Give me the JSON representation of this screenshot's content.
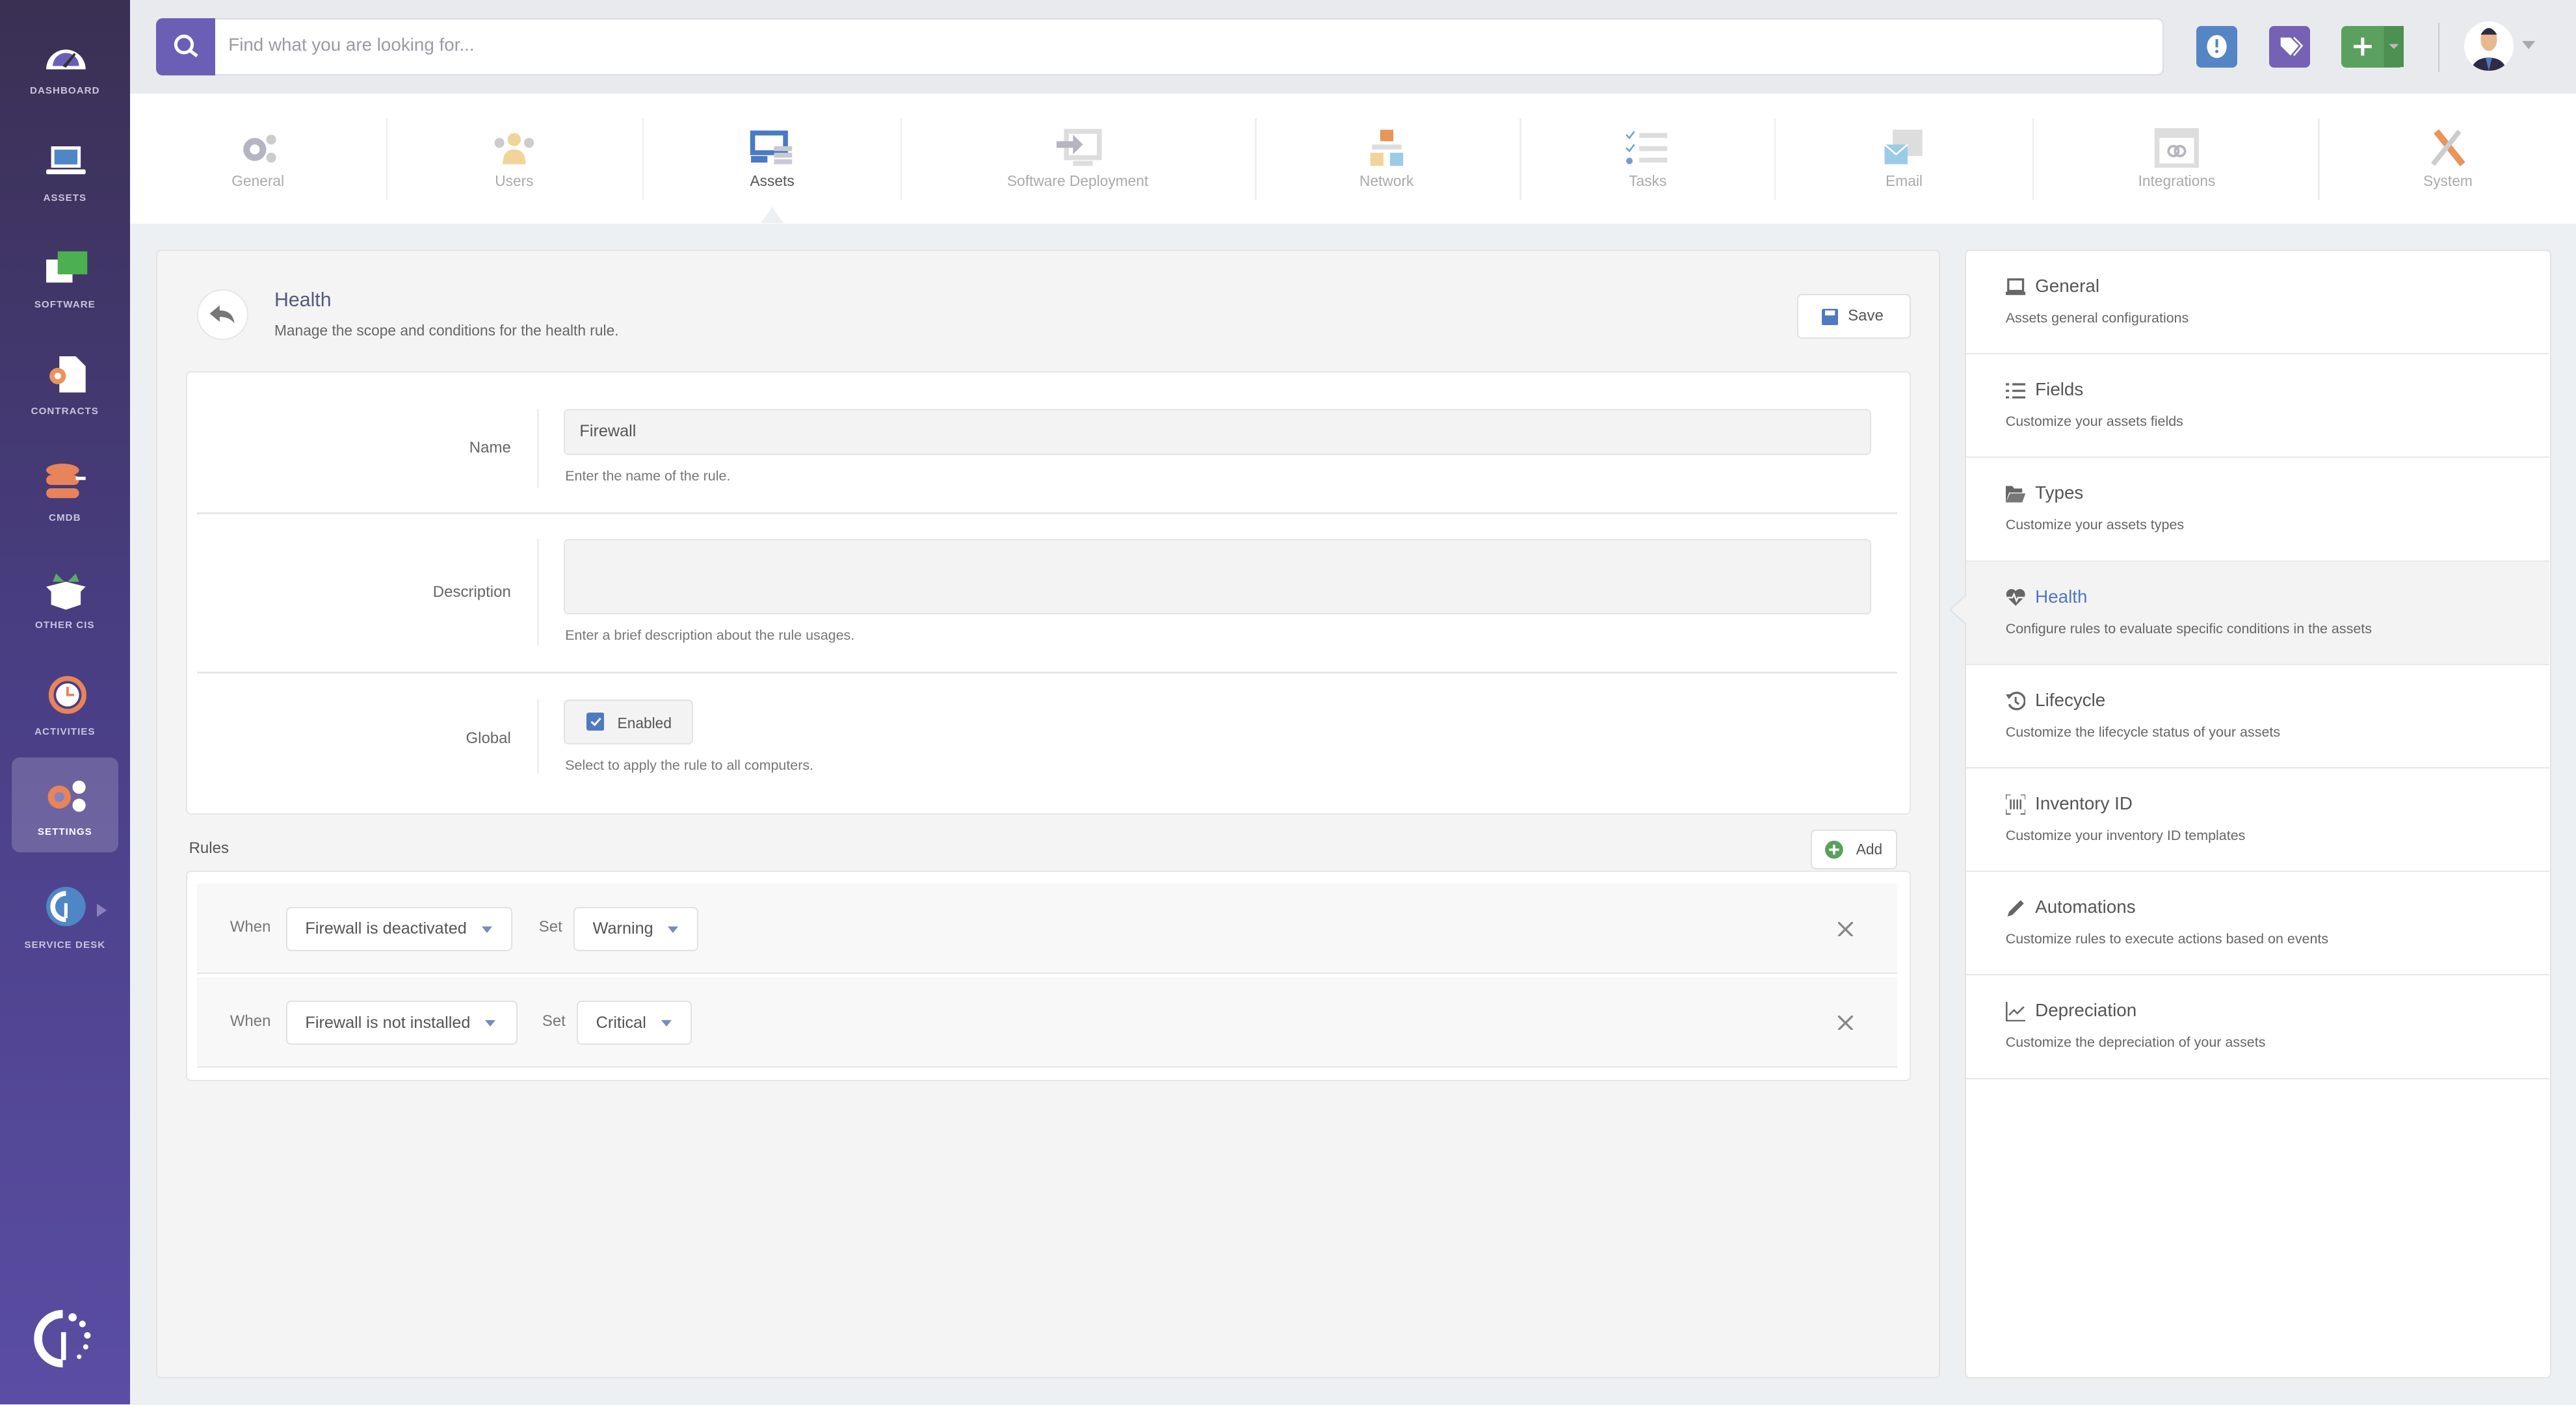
{
  "sidebar": {
    "items": [
      {
        "label": "DASHBOARD",
        "icon": "dashboard-icon"
      },
      {
        "label": "ASSETS",
        "icon": "laptop-icon"
      },
      {
        "label": "SOFTWARE",
        "icon": "software-icon"
      },
      {
        "label": "CONTRACTS",
        "icon": "contract-icon"
      },
      {
        "label": "CMDB",
        "icon": "database-icon"
      },
      {
        "label": "OTHER CIS",
        "icon": "box-icon"
      },
      {
        "label": "ACTIVITIES",
        "icon": "history-icon"
      },
      {
        "label": "SETTINGS",
        "icon": "gears-icon",
        "active": true
      },
      {
        "label": "SERVICE DESK",
        "icon": "service-desk-icon"
      }
    ]
  },
  "search": {
    "placeholder": "Find what you are looking for..."
  },
  "tabs": [
    {
      "label": "General"
    },
    {
      "label": "Users"
    },
    {
      "label": "Assets",
      "active": true
    },
    {
      "label": "Software Deployment"
    },
    {
      "label": "Network"
    },
    {
      "label": "Tasks"
    },
    {
      "label": "Email"
    },
    {
      "label": "Integrations"
    },
    {
      "label": "System"
    }
  ],
  "header": {
    "title": "Health",
    "subtitle": "Manage the scope and conditions for the health rule.",
    "save_label": "Save"
  },
  "form": {
    "name": {
      "label": "Name",
      "value": "Firewall",
      "help": "Enter the name of the rule."
    },
    "description": {
      "label": "Description",
      "value": "",
      "help": "Enter a brief description about the rule usages."
    },
    "global": {
      "label": "Global",
      "checkbox_label": "Enabled",
      "checked": true,
      "help": "Select to apply the rule to all computers."
    }
  },
  "rules": {
    "label": "Rules",
    "add_label": "Add",
    "when_label": "When",
    "set_label": "Set",
    "items": [
      {
        "condition": "Firewall is deactivated",
        "status": "Warning"
      },
      {
        "condition": "Firewall is not installed",
        "status": "Critical"
      }
    ]
  },
  "settings_menu": [
    {
      "title": "General",
      "desc": "Assets general configurations"
    },
    {
      "title": "Fields",
      "desc": "Customize your assets fields"
    },
    {
      "title": "Types",
      "desc": "Customize your assets types"
    },
    {
      "title": "Health",
      "desc": "Configure rules to evaluate specific conditions in the assets",
      "active": true
    },
    {
      "title": "Lifecycle",
      "desc": "Customize the lifecycle status of your assets"
    },
    {
      "title": "Inventory ID",
      "desc": "Customize your inventory ID templates"
    },
    {
      "title": "Automations",
      "desc": "Customize rules to execute actions based on events"
    },
    {
      "title": "Depreciation",
      "desc": "Customize the depreciation of your assets"
    }
  ],
  "colors": {
    "accent": "#6b5fb5",
    "link": "#4f79c0",
    "alert": "#5585c5",
    "tags": "#7562b4",
    "add": "#5aa05e"
  }
}
